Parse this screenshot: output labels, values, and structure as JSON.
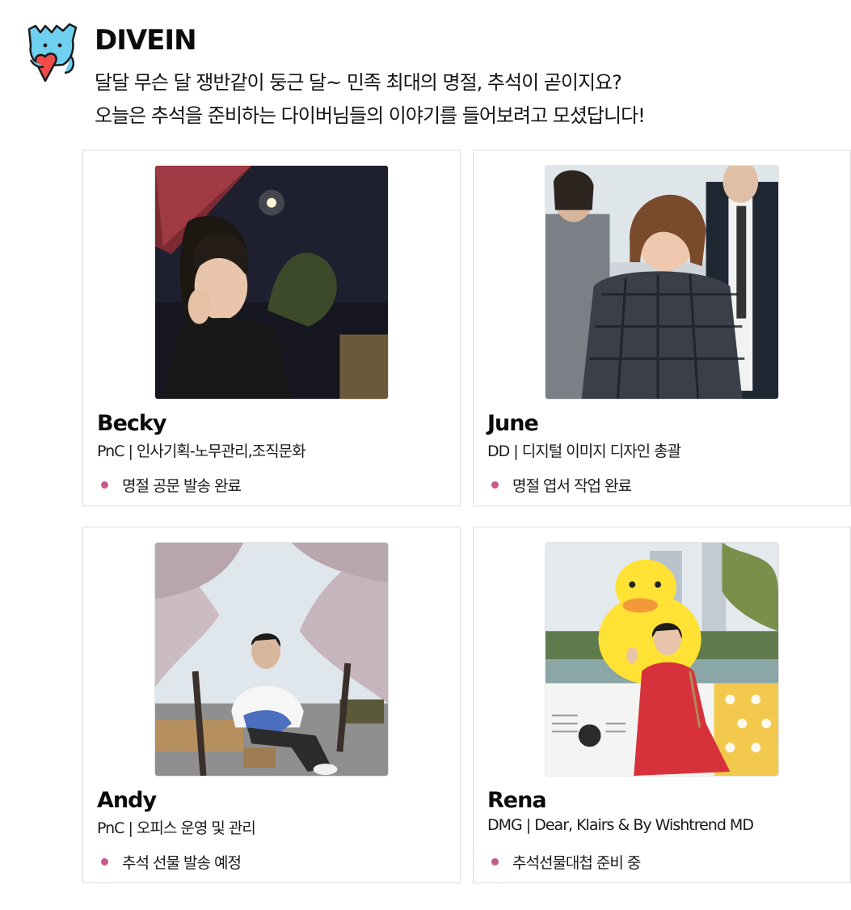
{
  "header": {
    "brand": "DIVEIN",
    "intro_line1": "달달 무슨 달 쟁반같이 둥근 달~ 민족 최대의 명절, 추석이 곧이지요?",
    "intro_line2": "오늘은 추석을 준비하는 다이버님들의 이야기를 들어보려고 모셨답니다!",
    "logo_icon": "heart-hugging-mascot-icon"
  },
  "accent_colors": {
    "bullet": "#c85a8a",
    "logo_blue": "#6fd0f0",
    "logo_heart": "#ee4b4b"
  },
  "members": [
    {
      "name": "Becky",
      "role": "PnC | 인사기획-노무관리,조직문화",
      "task": "명절 공문 발송 완료"
    },
    {
      "name": "June",
      "role": "DD | 디지털 이미지 디자인 총괄",
      "task": "명절 엽서 작업 완료"
    },
    {
      "name": "Andy",
      "role": "PnC | 오피스 운영 및 관리",
      "task": "추석 선물 발송 예정"
    },
    {
      "name": "Rena",
      "role": "DMG | Dear, Klairs & By Wishtrend MD",
      "task": "추석선물대첩 준비 중"
    }
  ]
}
